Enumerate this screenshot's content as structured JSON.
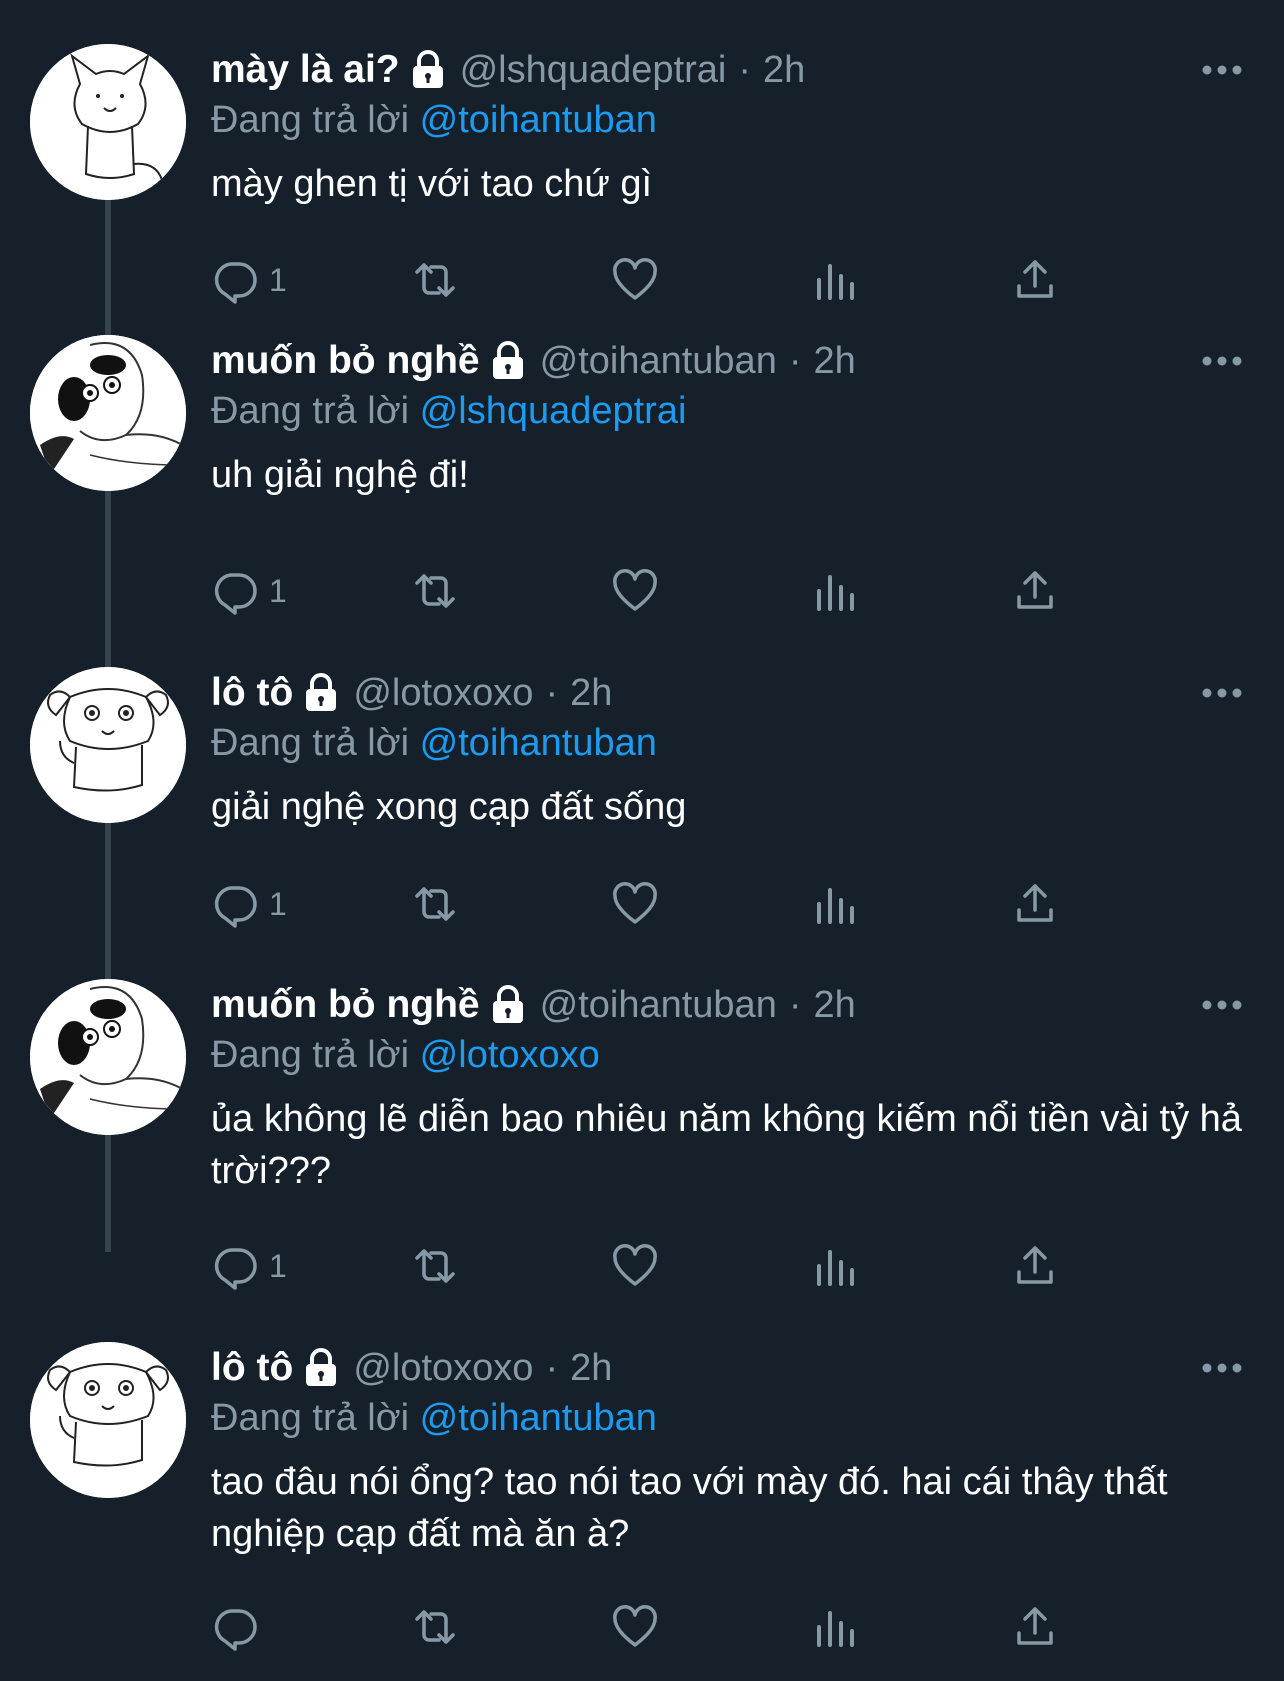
{
  "tweets": [
    {
      "name": "mày là ai?",
      "handle": "@lshquadeptrai",
      "time": "2h",
      "sep": "·",
      "replying_prefix": "Đang trả lời",
      "replying_to": "@toihantuban",
      "text": "mày ghen tị với tao chứ gì",
      "reply_count": "1",
      "avatar": "cat-drawing"
    },
    {
      "name": "muốn bỏ nghề",
      "handle": "@toihantuban",
      "time": "2h",
      "sep": "·",
      "replying_prefix": "Đang trả lời",
      "replying_to": "@lshquadeptrai",
      "text": "uh giải nghệ đi!",
      "reply_count": "1",
      "avatar": "face-sketch"
    },
    {
      "name": "lô tô",
      "handle": "@lotoxoxo",
      "time": "2h",
      "sep": "·",
      "replying_prefix": "Đang trả lời",
      "replying_to": "@toihantuban",
      "text": "giải nghệ xong cạp đất sống",
      "reply_count": "1",
      "avatar": "dog-drawing"
    },
    {
      "name": "muốn bỏ nghề",
      "handle": "@toihantuban",
      "time": "2h",
      "sep": "·",
      "replying_prefix": "Đang trả lời",
      "replying_to": "@lotoxoxo",
      "text": "ủa không lẽ diễn bao nhiêu năm không kiếm nổi tiền vài tỷ hả trời???",
      "reply_count": "1",
      "avatar": "face-sketch"
    },
    {
      "name": "lô tô",
      "handle": "@lotoxoxo",
      "time": "2h",
      "sep": "·",
      "replying_prefix": "Đang trả lời",
      "replying_to": "@toihantuban",
      "text": "tao đâu nói ổng? tao nói tao với mày đó. hai cái thây thất nghiệp cạp đất mà ăn à?",
      "reply_count": "",
      "avatar": "dog-drawing"
    }
  ],
  "icons": {
    "lock": "lock-icon",
    "more": "more-icon",
    "reply": "reply-icon",
    "retweet": "retweet-icon",
    "like": "heart-icon",
    "analytics": "analytics-icon",
    "share": "share-icon"
  },
  "colors": {
    "background": "#15202b",
    "secondary_text": "#8899a6",
    "mention": "#1d9bf0",
    "thread_line": "#38444d"
  }
}
